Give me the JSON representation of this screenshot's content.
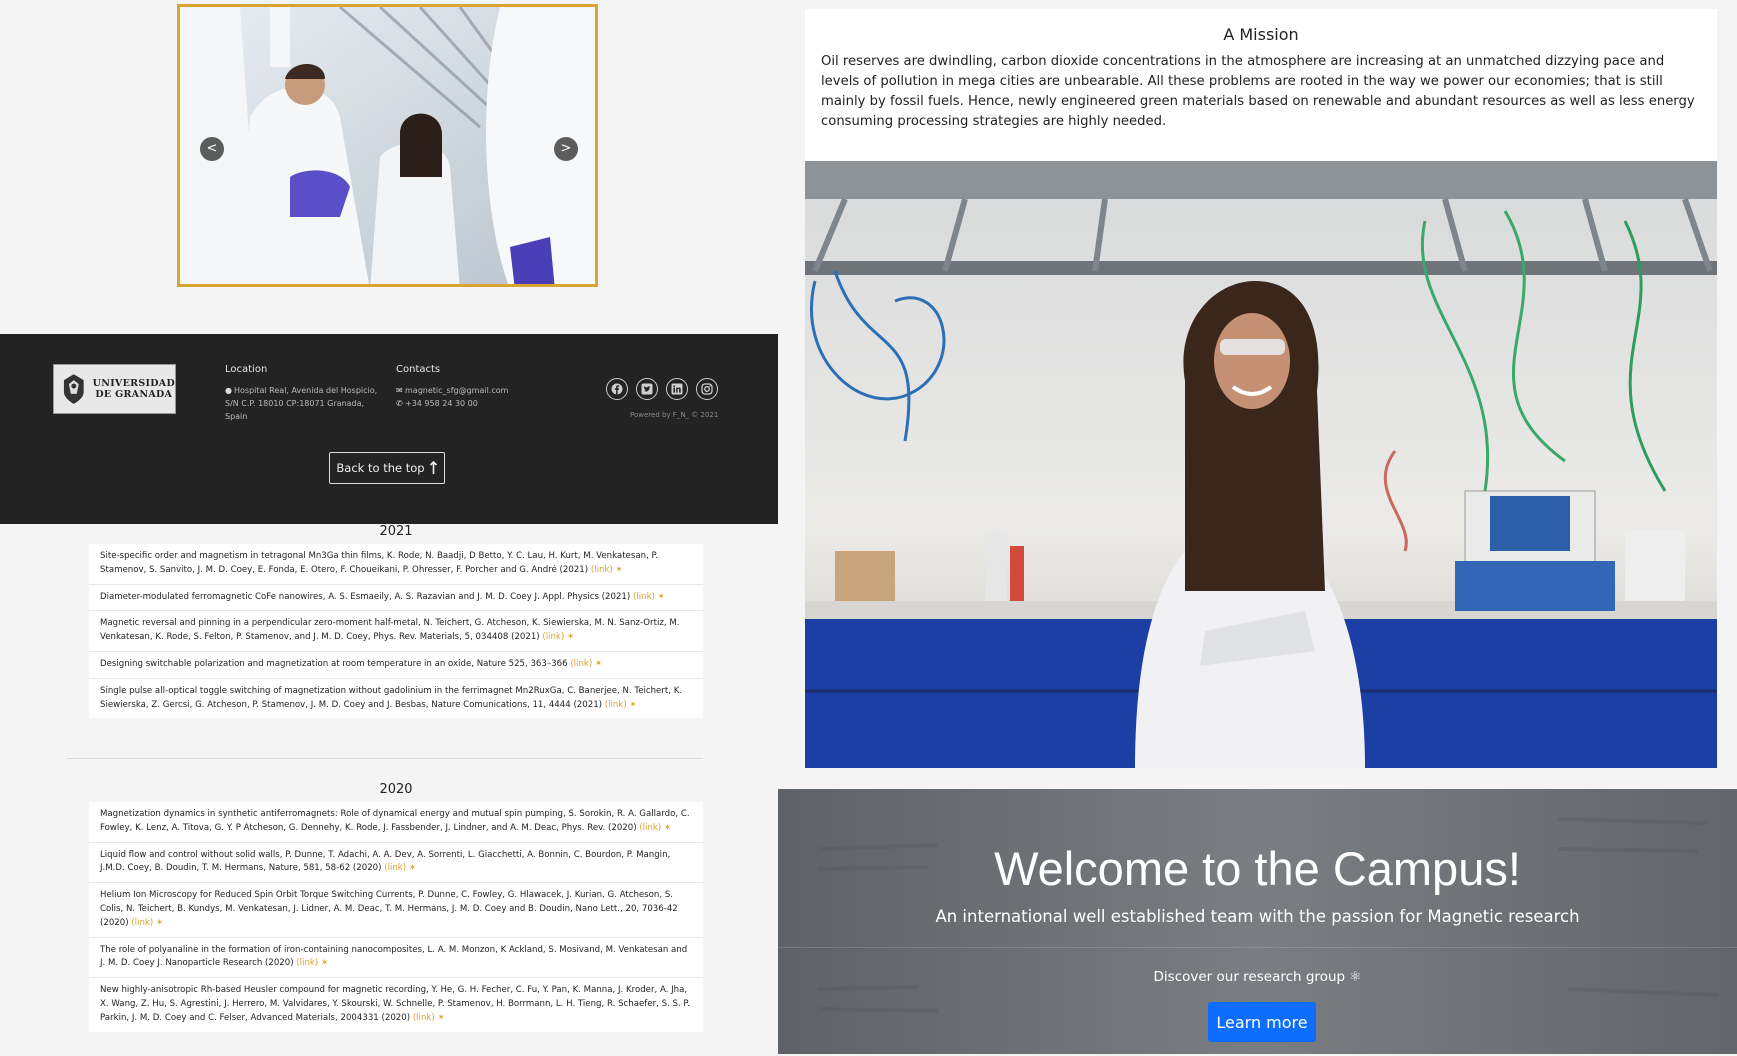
{
  "carousel": {
    "prev_label": "<",
    "next_label": ">",
    "photo_icon": "team-in-lab-photo"
  },
  "footer": {
    "logo": {
      "line1": "UNIVERSIDAD",
      "line2": "DE GRANADA"
    },
    "location": {
      "heading": "Location",
      "line1": "Hospital Real, Avenida del Hospicio,",
      "line2": "S/N C.P. 18010 CP:18071 Granada,",
      "line3": "Spain"
    },
    "contacts": {
      "heading": "Contacts",
      "email": "magnetic_sfg@gmail.com",
      "phone": "+34 958 24 30 00"
    },
    "social_icons": [
      "facebook-icon",
      "twitter-icon",
      "linkedin-icon",
      "instagram-icon"
    ],
    "powered_by": "Powered by F_N_ © 2021",
    "back_to_top": "Back to the top"
  },
  "publications": [
    {
      "year": "2021",
      "items": [
        {
          "text": "Site-specific order and magnetism in tetragonal Mn3Ga thin films, K. Rode, N. Baadji, D Betto, Y. C. Lau, H. Kurt, M. Venkatesan, P. Stamenov, S. Sanvito, J. M. D. Coey, E. Fonda, E. Otero, F. Choueikani, P. Ohresser, F. Porcher and G. André (2021)",
          "link": "(link)"
        },
        {
          "text": "Diameter-modulated ferromagnetic CoFe nanowires, A. S. Esmaeily, A. S. Razavian and J. M. D. Coey J. Appl. Physics (2021)",
          "link": "(link)"
        },
        {
          "text": "Magnetic reversal and pinning in a perpendicular zero-moment half-metal, N. Teichert, G. Atcheson, K. Siewierska, M. N. Sanz-Ortiz, M. Venkatesan, K. Rode, S. Felton, P. Stamenov, and J. M. D. Coey, Phys. Rev. Materials, 5, 034408 (2021)",
          "link": "(link)"
        },
        {
          "text": "Designing switchable polarization and magnetization at room temperature in an oxide, Nature 525, 363–366",
          "link": "(link)"
        },
        {
          "text": "Single pulse all-optical toggle switching of magnetization without gadolinium in the ferrimagnet Mn2RuxGa, C. Banerjee, N. Teichert, K. Siewierska, Z. Gercsi, G. Atcheson, P. Stamenov, J. M. D. Coey and J. Besbas, Nature Comunications, 11, 4444 (2021)",
          "link": "(link)"
        }
      ]
    },
    {
      "year": "2020",
      "items": [
        {
          "text": "Magnetization dynamics in synthetic antiferromagnets: Role of dynamical energy and mutual spin pumping, S. Sorokin, R. A. Gallardo, C. Fowley, K. Lenz, A. Titova, G. Y. P Atcheson, G. Dennehy, K. Rode, J. Fassbender, J. Lindner, and A. M. Deac, Phys. Rev. (2020)",
          "link": "(link)"
        },
        {
          "text": "Liquid flow and control without solid walls, P. Dunne, T. Adachi, A. A. Dev, A. Sorrenti, L. Giacchetti, A. Bonnin, C. Bourdon, P. Mangin, J.M.D. Coey, B. Doudin, T. M. Hermans, Nature, 581, 58-62 (2020)",
          "link": "(link)"
        },
        {
          "text": "Helium Ion Microscopy for Reduced Spin Orbit Torque Switching Currents, P. Dunne, C. Fowley, G. Hlawacek, J. Kurian, G. Atcheson, S. Colis, N. Teichert, B. Kundys, M. Venkatesan, J. Lidner, A. M. Deac, T. M. Hermans, J. M. D. Coey and B. Doudin, Nano Lett., 20, 7036-42 (2020)",
          "link": "(link)"
        },
        {
          "text": "The role of polyanaline in the formation of iron-containing nanocomposites, L. A. M. Monzon, K Ackland, S. Mosivand, M. Venkatesan and J. M. D. Coey J. Nanoparticle Research (2020)",
          "link": "(link)"
        },
        {
          "text": "New highly-anisotropic Rh-based Heusler compound for magnetic recording, Y. He, G. H. Fecher, C. Fu, Y. Pan, K. Manna, J. Kroder, A. Jha, X. Wang, Z. Hu, S. Agrestini, J. Herrero, M. Valvidares, Y. Skourski, W. Schnelle, P. Stamenov, H. Borrmann, L. H. Tieng, R. Schaefer, S. S. P. Parkin, J. M. D. Coey and C. Felser, Advanced Materials, 2004331 (2020)",
          "link": "(link)"
        }
      ]
    }
  ],
  "mission": {
    "title": "A Mission",
    "text": "Oil reserves are dwindling, carbon dioxide concentrations in the atmosphere are increasing at an unmatched dizzying pace and levels of pollution in mega cities are unbearable. All these problems are rooted in the way we power our economies; that is still mainly by fossil fuels. Hence, newly engineered green materials based on renewable and abundant resources as well as less energy consuming processing strategies are highly needed."
  },
  "welcome": {
    "title": "Welcome to the Campus!",
    "subtitle": "An international well established team with the passion for Magnetic research",
    "discover": "Discover our research group",
    "learn_more": "Learn more"
  },
  "colors": {
    "accent_gold": "#d9a430",
    "footer_bg": "#232323",
    "button_blue": "#0d6efd"
  }
}
